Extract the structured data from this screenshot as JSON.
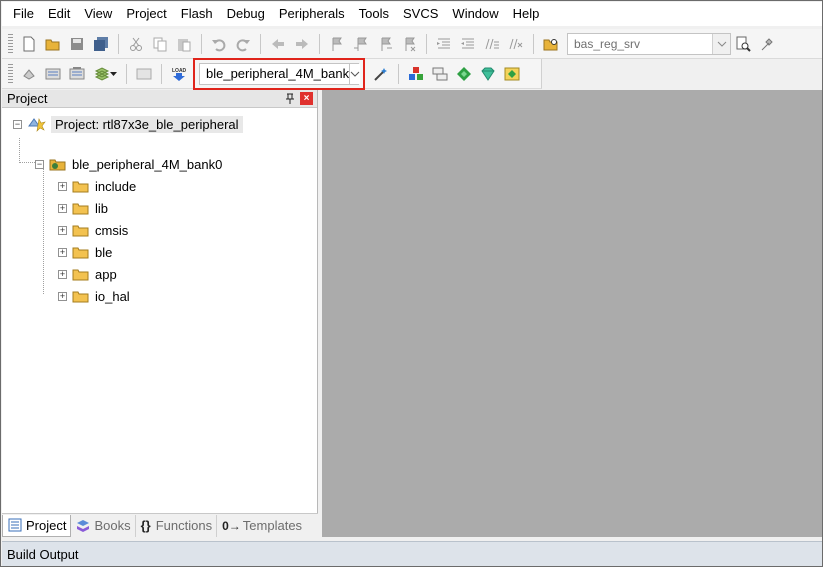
{
  "menu": [
    "File",
    "Edit",
    "View",
    "Project",
    "Flash",
    "Debug",
    "Peripherals",
    "Tools",
    "SVCS",
    "Window",
    "Help"
  ],
  "toolbar": {
    "function_combo_value": "bas_reg_srv",
    "target_combo_value": "ble_peripheral_4M_bank",
    "load_label": "LOAD"
  },
  "project_panel": {
    "title": "Project",
    "root": "Project: rtl87x3e_ble_peripheral",
    "target": "ble_peripheral_4M_bank0",
    "groups": [
      "include",
      "lib",
      "cmsis",
      "ble",
      "app",
      "io_hal"
    ]
  },
  "tabs": {
    "project": "Project",
    "books": "Books",
    "functions": "Functions",
    "templates": "Templates",
    "functions_glyph": "{}",
    "templates_glyph": "0→"
  },
  "build_output": "Build Output",
  "colors": {
    "highlight": "#e0241b",
    "editor_bg": "#ababab",
    "folder": "#e8b33a"
  }
}
